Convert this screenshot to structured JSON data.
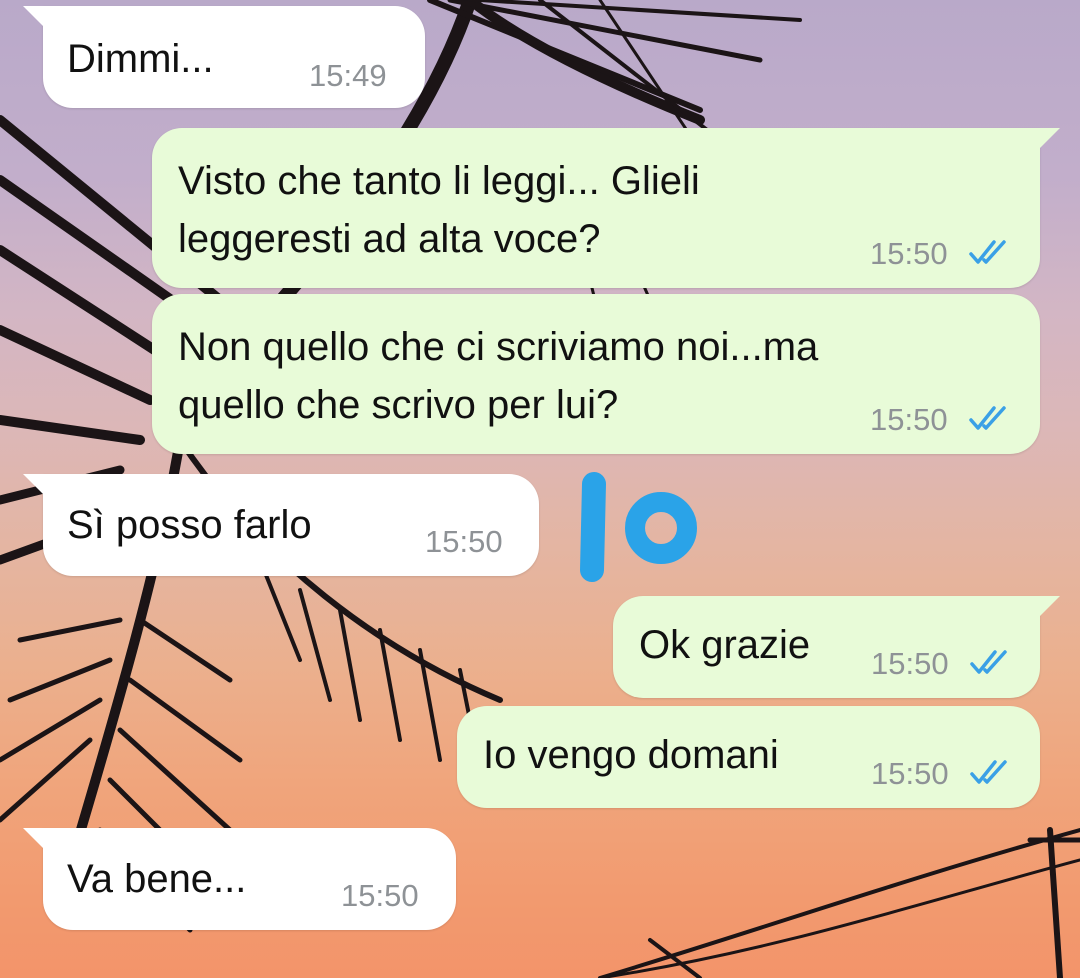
{
  "colors": {
    "incoming_bubble": "#ffffff",
    "outgoing_bubble": "#e8fbd8",
    "read_ticks": "#3aa0e6",
    "annotation": "#2aa3e8"
  },
  "messages": [
    {
      "text": "Dimmi...",
      "time": "15:49",
      "direction": "incoming",
      "status": null
    },
    {
      "text": "Visto che tanto li leggi... Glieli\nleggeresti ad alta voce?",
      "time": "15:50",
      "direction": "outgoing",
      "status": "read"
    },
    {
      "text": "Non quello che ci scriviamo noi...ma\nquello che scrivo per lui?",
      "time": "15:50",
      "direction": "outgoing",
      "status": "read"
    },
    {
      "text": "Sì posso farlo",
      "time": "15:50",
      "direction": "incoming",
      "status": null
    },
    {
      "text": "Ok grazie",
      "time": "15:50",
      "direction": "outgoing",
      "status": "read"
    },
    {
      "text": "Io vengo domani",
      "time": "15:50",
      "direction": "outgoing",
      "status": "read"
    },
    {
      "text": "Va bene...",
      "time": "15:50",
      "direction": "incoming",
      "status": null
    }
  ],
  "annotation": {
    "text": "IO",
    "icon": "handwritten-annotation"
  },
  "background": {
    "icon": "palm-tree-sunset-wallpaper"
  }
}
